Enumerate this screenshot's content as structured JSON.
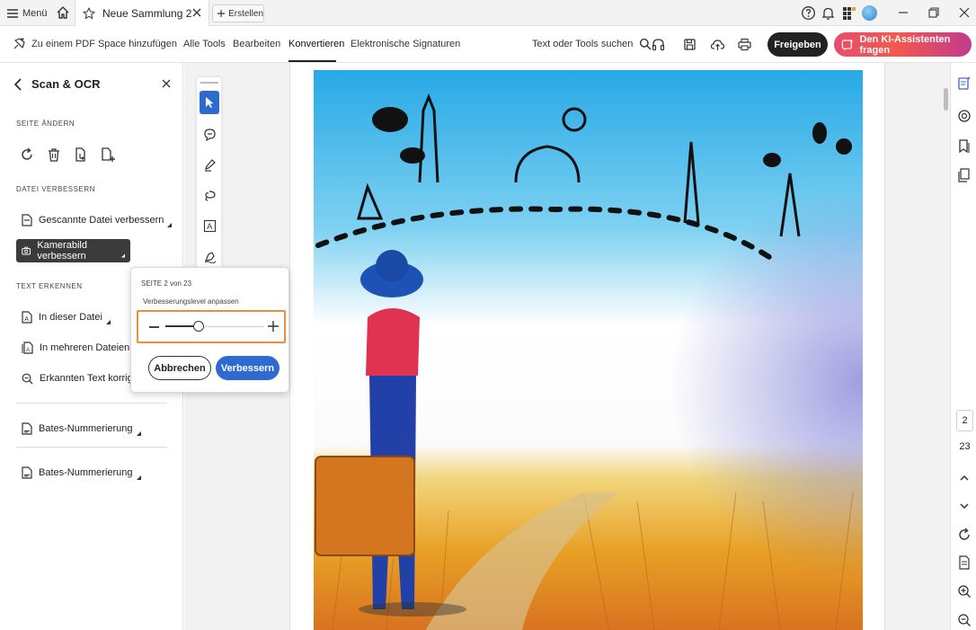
{
  "titlebar": {
    "menu_label": "Menü",
    "tab_title": "Neue Sammlung 2",
    "create_label": "Erstellen"
  },
  "toolbar": {
    "pdf_space": "Zu einem PDF Space hinzufügen",
    "nav": [
      "Alle Tools",
      "Bearbeiten",
      "Konvertieren",
      "Elektronische Signaturen"
    ],
    "active_nav": "Konvertieren",
    "search_tools": "Text oder Tools suchen",
    "share_label": "Freigeben",
    "ai_label": "Den KI-Assistenten fragen"
  },
  "left_panel": {
    "title": "Scan & OCR",
    "section_page": "SEITE ÄNDERN",
    "section_improve": "DATEI VERBESSERN",
    "improve_items": [
      "Gescannte Datei verbessern",
      "Kamerabild verbessern"
    ],
    "section_recognize": "TEXT ERKENNEN",
    "recognize_items": [
      "In dieser Datei",
      "In mehreren Dateien",
      "Erkannten Text korrigieren"
    ],
    "bates_items": [
      "Bates-Nummerierung",
      "Bates-Nummerierung"
    ]
  },
  "popup": {
    "page_info": "SEITE 2 von 23",
    "level_label": "Verbesserungslevel anpassen",
    "slider_value": 0.34,
    "cancel_label": "Abbrechen",
    "improve_label": "Verbessern"
  },
  "right_rail": {
    "current_page": "2",
    "total_pages": "23"
  },
  "colors": {
    "primary_blue": "#2d6bd1",
    "highlight_orange": "#e8913a",
    "dark_button": "#222222",
    "ai_gradient_start": "#e84c6e",
    "ai_gradient_end": "#c13a8f"
  }
}
